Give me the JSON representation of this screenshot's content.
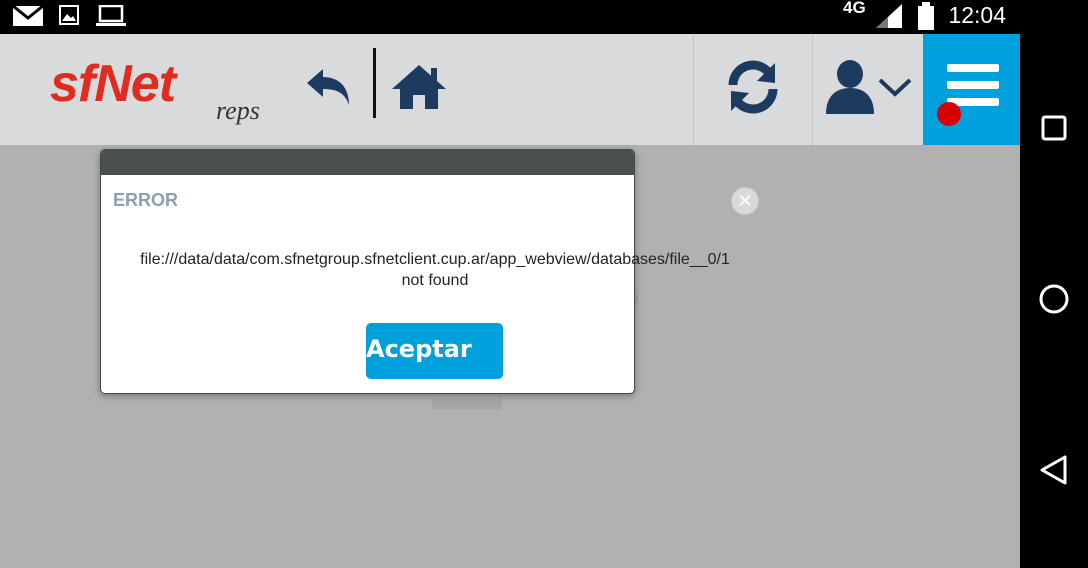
{
  "status_bar": {
    "time": "12:04",
    "network": "4G",
    "icons": [
      "mail-icon",
      "image-icon",
      "laptop-icon",
      "signal-icon",
      "battery-icon"
    ]
  },
  "header": {
    "logo_main": "sfNet",
    "logo_sub": "reps",
    "icons": [
      "back-icon",
      "home-icon",
      "refresh-icon",
      "user-icon",
      "chevron-down-icon",
      "menu-icon"
    ],
    "accent_color": "#00a0dc",
    "brand_color": "#e02b20",
    "notification_color": "#d90000"
  },
  "dialog": {
    "title": "ERROR",
    "message_line1": "file:///data/data/com.sfnetgroup.sfnetclient.cup.ar/app_webview/databases/file__0/1",
    "message_line2": "not found",
    "accept_label": "Aceptar",
    "close_icon": "close-icon"
  },
  "nav_bar": {
    "buttons": [
      "recents-icon",
      "home-circle-icon",
      "back-triangle-icon"
    ]
  }
}
